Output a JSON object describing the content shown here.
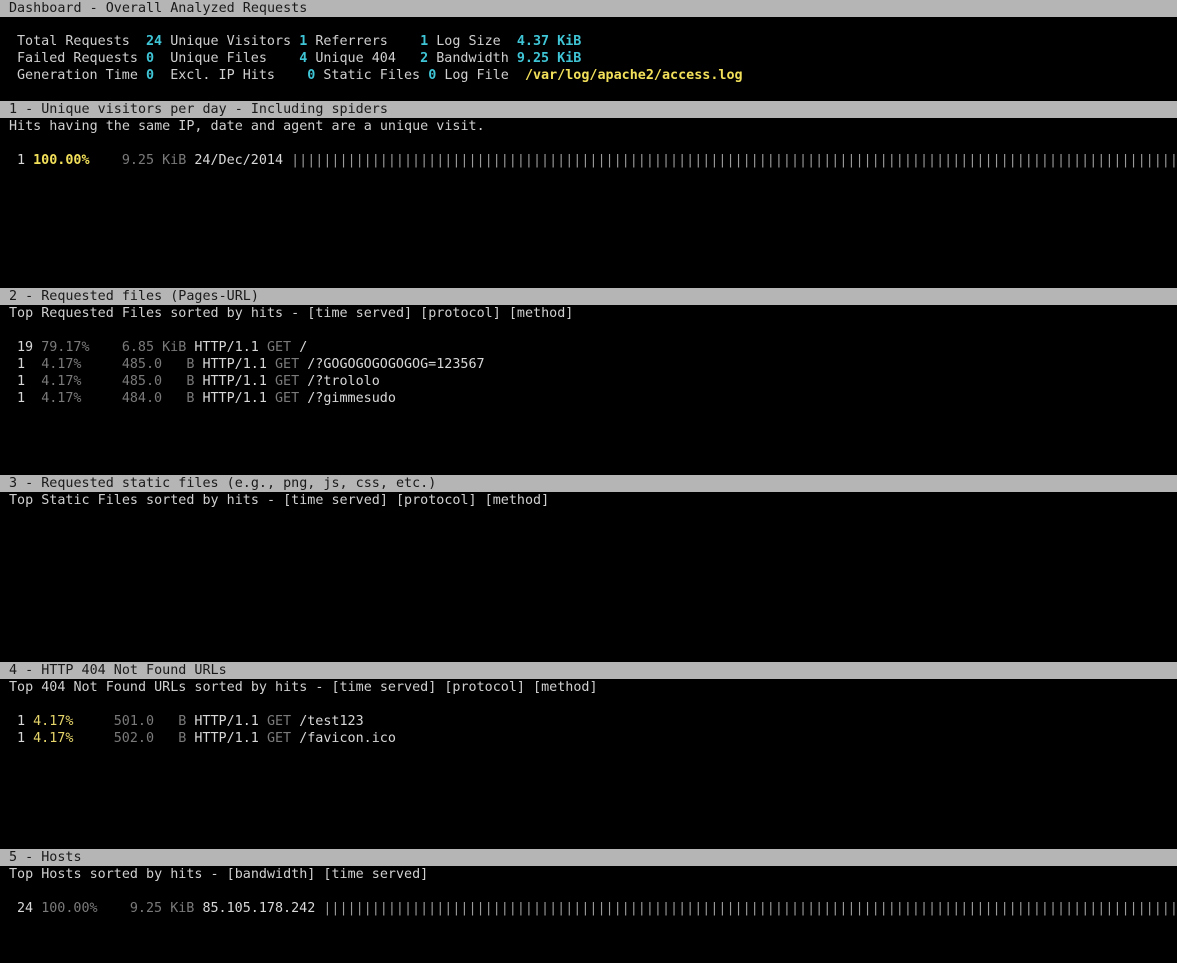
{
  "title": "Dashboard - Overall Analyzed Requests",
  "overall": {
    "row1": [
      {
        "label": "Total Requests",
        "value": "24"
      },
      {
        "label": "Unique Visitors",
        "value": "1"
      },
      {
        "label": "Referrers",
        "value": "1"
      },
      {
        "label": "Log Size",
        "value": "4.37 KiB"
      }
    ],
    "row2": [
      {
        "label": "Failed Requests",
        "value": "0"
      },
      {
        "label": "Unique Files",
        "value": "4"
      },
      {
        "label": "Unique 404",
        "value": "2"
      },
      {
        "label": "Bandwidth",
        "value": "9.25 KiB"
      }
    ],
    "row3": [
      {
        "label": "Generation Time",
        "value": "0"
      },
      {
        "label": "Excl. IP Hits",
        "value": "0"
      },
      {
        "label": "Static Files",
        "value": "0"
      },
      {
        "label": "Log File",
        "value": "/var/log/apache2/access.log"
      }
    ]
  },
  "panels": [
    {
      "header": "1 - Unique visitors per day - Including spiders",
      "desc": "Hits having the same IP, date and agent are a unique visit.",
      "rows": [
        {
          "hits": "1",
          "pct": "100.00%",
          "size": "9.25",
          "unit": "KiB",
          "data": "24/Dec/2014",
          "bar_fraction": 1.0
        }
      ]
    },
    {
      "header": "2 - Requested files (Pages-URL)",
      "desc": "Top Requested Files sorted by hits - [time served] [protocol] [method]",
      "rows": [
        {
          "hits": "19",
          "pct": "79.17%",
          "size": "6.85",
          "unit": "KiB",
          "protocol": "HTTP/1.1",
          "method": "GET",
          "data": "/"
        },
        {
          "hits": "1",
          "pct": "4.17%",
          "size": "485.0",
          "unit": "B",
          "protocol": "HTTP/1.1",
          "method": "GET",
          "data": "/?GOGOGOGOGOGOG=123567"
        },
        {
          "hits": "1",
          "pct": "4.17%",
          "size": "485.0",
          "unit": "B",
          "protocol": "HTTP/1.1",
          "method": "GET",
          "data": "/?trololo"
        },
        {
          "hits": "1",
          "pct": "4.17%",
          "size": "484.0",
          "unit": "B",
          "protocol": "HTTP/1.1",
          "method": "GET",
          "data": "/?gimmesudo"
        }
      ]
    },
    {
      "header": "3 - Requested static files (e.g., png, js, css, etc.)",
      "desc": "Top Static Files sorted by hits - [time served] [protocol] [method]",
      "rows": []
    },
    {
      "header": "4 - HTTP 404 Not Found URLs",
      "desc": "Top 404 Not Found URLs sorted by hits - [time served] [protocol] [method]",
      "rows": [
        {
          "hits": "1",
          "pct": "4.17%",
          "size": "501.0",
          "unit": "B",
          "protocol": "HTTP/1.1",
          "method": "GET",
          "data": "/test123"
        },
        {
          "hits": "1",
          "pct": "4.17%",
          "size": "502.0",
          "unit": "B",
          "protocol": "HTTP/1.1",
          "method": "GET",
          "data": "/favicon.ico"
        }
      ]
    },
    {
      "header": "5 - Hosts",
      "desc": "Top Hosts sorted by hits - [bandwidth] [time served]",
      "rows": [
        {
          "hits": "24",
          "pct": "100.00%",
          "size": "9.25",
          "unit": "KiB",
          "data": "85.105.178.242",
          "bar_fraction": 1.0
        }
      ]
    }
  ]
}
